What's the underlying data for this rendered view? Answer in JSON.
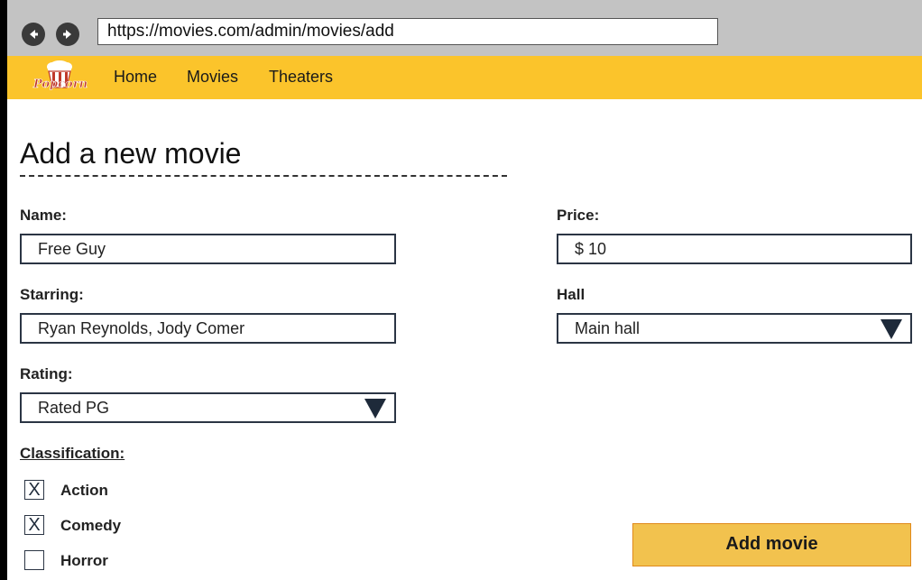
{
  "browser": {
    "url": "https://movies.com/admin/movies/add"
  },
  "header": {
    "logo_text": "Popcorn",
    "nav": [
      "Home",
      "Movies",
      "Theaters"
    ]
  },
  "page": {
    "title": "Add a new movie"
  },
  "form": {
    "name": {
      "label": "Name:",
      "value": "Free Guy"
    },
    "starring": {
      "label": "Starring:",
      "value": "Ryan Reynolds, Jody Comer"
    },
    "rating": {
      "label": "Rating:",
      "value": "Rated PG"
    },
    "price": {
      "label": "Price:",
      "value": "$ 10"
    },
    "hall": {
      "label": "Hall",
      "value": "Main hall"
    },
    "classification": {
      "label": "Classification:",
      "options": [
        {
          "label": "Action",
          "checked": true,
          "mark": "X"
        },
        {
          "label": "Comedy",
          "checked": true,
          "mark": "X"
        },
        {
          "label": "Horror",
          "checked": false,
          "mark": ""
        }
      ]
    },
    "submit_label": "Add movie"
  },
  "colors": {
    "header_bg": "#fbc42b",
    "button_bg": "#f2c24e",
    "button_border": "#e08a1c",
    "field_border": "#2b3544"
  }
}
